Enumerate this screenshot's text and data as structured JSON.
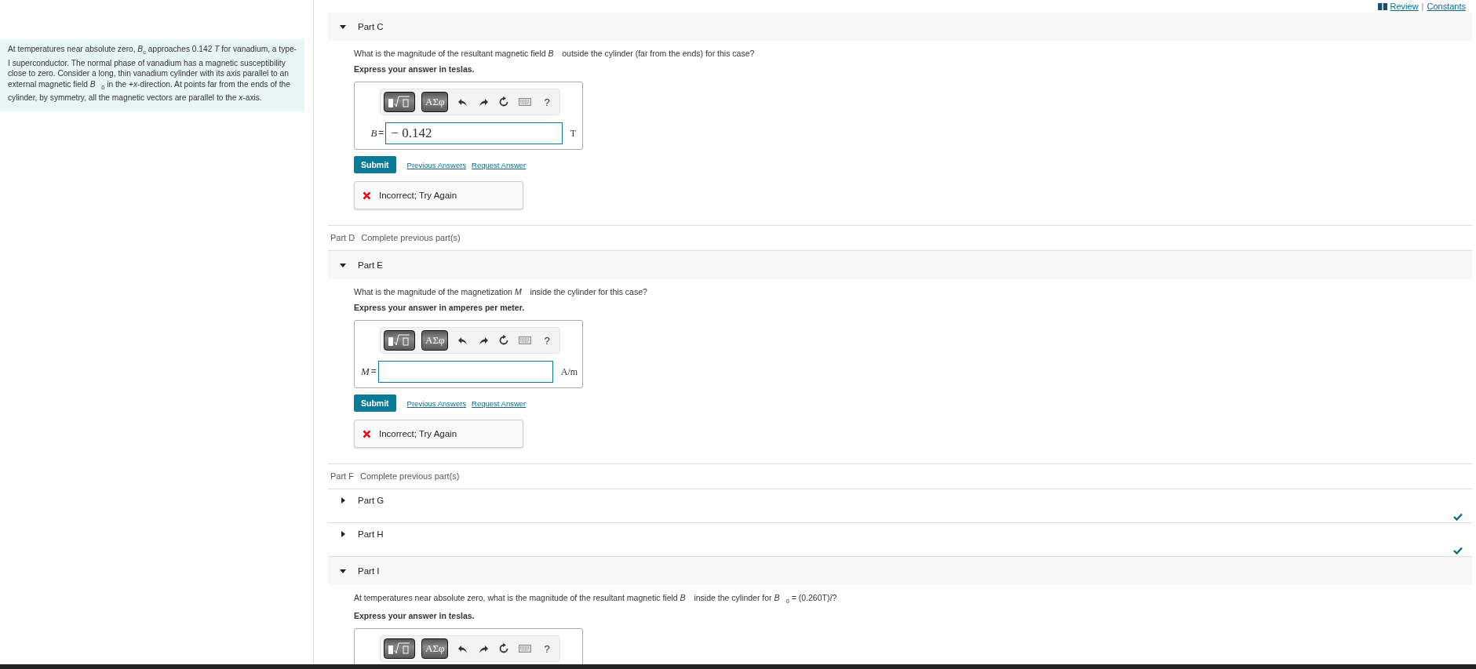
{
  "top_links": {
    "review": "Review",
    "separator": "|",
    "constants": "Constants"
  },
  "intro": "At temperatures near absolute zero, *B*$_{c}$ approaches 0.142 *T* for vanadium, a type-I superconductor. The normal phase of vanadium has a magnetic susceptibility close to zero. Consider a long, thin vanadium cylinder with its axis parallel to an external magnetic field *B⃗*$_{0}$ in the +*x*-direction. At points far from the ends of the cylinder, by symmetry, all the magnetic vectors are parallel to the *x*-axis.",
  "parts": [
    {
      "kind": "question",
      "label": "Part C",
      "expanded": true,
      "question": "What is the magnitude of the resultant magnetic field *B⃗* outside the cylinder (far from the ends) for this case?",
      "instruction": "Express your answer in teslas.",
      "answer": {
        "symbols": "ΑΣφ",
        "help": "?",
        "variable": "B",
        "equals": "=",
        "value": "− 0.142",
        "unit": "T"
      },
      "submit": "Submit",
      "links": [
        "Previous Answers",
        "Request Answer"
      ],
      "feedback": "Incorrect; Try Again"
    },
    {
      "kind": "locked",
      "label": "Part D",
      "note": "Complete previous part(s)"
    },
    {
      "kind": "question",
      "label": "Part E",
      "expanded": true,
      "question": "What is the magnitude of the magnetization *M⃗* inside the cylinder for this case?",
      "instruction": "Express your answer in amperes per meter.",
      "answer": {
        "symbols": "ΑΣφ",
        "help": "?",
        "variable": "M",
        "equals": "=",
        "unit": "A/m"
      },
      "submit": "Submit",
      "links": [
        "Previous Answers",
        "Request Answer"
      ],
      "feedback": "Incorrect; Try Again"
    },
    {
      "kind": "locked",
      "label": "Part F",
      "note": "Complete previous part(s)"
    },
    {
      "kind": "question",
      "label": "Part G",
      "expanded": false,
      "completed": true
    },
    {
      "kind": "question",
      "label": "Part H",
      "expanded": false,
      "completed": true
    },
    {
      "kind": "question",
      "label": "Part I",
      "expanded": true,
      "question": "At temperatures near absolute zero, what is the magnitude of the resultant magnetic field *B⃗* inside the cylinder for *B⃗*$_{0}$ = (0.260T)*î*?",
      "instruction": "Express your answer in teslas.",
      "answer": {
        "symbols": "ΑΣφ",
        "help": "?"
      }
    }
  ]
}
